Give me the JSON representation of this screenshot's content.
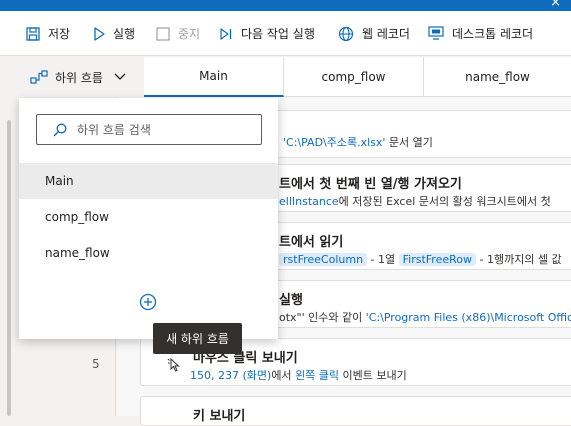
{
  "window": {
    "close_glyph": "×"
  },
  "toolbar": {
    "save": "저장",
    "run": "실행",
    "stop": "중지",
    "next": "다음 작업 실행",
    "web_recorder": "웹 레코더",
    "desktop_recorder": "데스크톱 레코더"
  },
  "subflow": {
    "label": "하위 흐름"
  },
  "tabs": [
    "Main",
    "comp_flow",
    "name_flow"
  ],
  "dropdown": {
    "search_placeholder": "하위 흐름 검색",
    "items": [
      "Main",
      "comp_flow",
      "name_flow"
    ],
    "selected_index": 0,
    "add_tooltip": "새 하위 흐름"
  },
  "lines": {
    "visible_number": "5"
  },
  "actions": [
    {
      "desc_path": "'C:\\PAD\\주소록.xlsx'",
      "desc_tail": " 문서 열기"
    },
    {
      "title": "트에서 첫 번째 빈 열/행 가져오기",
      "var": "ellInstance",
      "desc_tail": "에 저장된 Excel 문서의 활성 워크시트에서 첫"
    },
    {
      "title": "트에서 읽기",
      "chip1": "rstFreeColumn",
      "mid": " - 1열 ",
      "chip2": "FirstFreeRow",
      "desc_tail": " - 1행까지의 셀 값"
    },
    {
      "title": "실행",
      "pre": "otx\"' 인수와 같이 ",
      "path": "'C:\\Program Files (x86)\\Microsoft Office"
    },
    {
      "title": "마우스 클릭 보내기",
      "coords": "150, 237 (화면)",
      "mid": "에서 ",
      "click": "왼쪽 클릭",
      "desc_tail": " 이벤트 보내기"
    },
    {
      "title": "키 보내기"
    }
  ],
  "colors": {
    "accent": "#0f6cbd",
    "tooltip_bg": "#323130"
  }
}
